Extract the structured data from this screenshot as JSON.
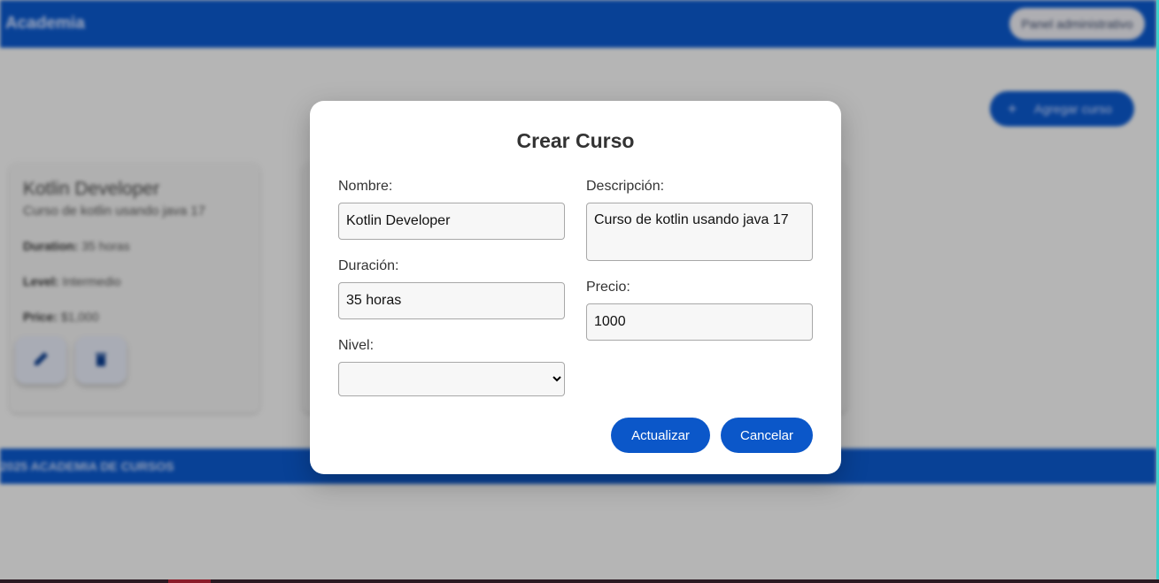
{
  "header": {
    "brand": "Academia",
    "admin_button": "Panel administrativo"
  },
  "toolbar": {
    "add_course_icon": "+",
    "add_course_label": "Agregar curso"
  },
  "course_card": {
    "title": "Kotlin Developer",
    "description": "Curso de kotlin usando java 17",
    "duration_label": "Duration:",
    "duration_value": "35 horas",
    "level_label": "Level:",
    "level_value": "Intermedio",
    "price_label": "Price:",
    "price_value": "$1,000",
    "edit_icon": "pencil-icon",
    "delete_icon": "trash-icon"
  },
  "footer": {
    "text": "2025 ACADEMIA DE CURSOS"
  },
  "modal": {
    "title": "Crear Curso",
    "name_label": "Nombre:",
    "name_value": "Kotlin Developer",
    "description_label": "Descripción:",
    "description_value": "Curso de kotlin usando java 17",
    "duration_label": "Duración:",
    "duration_value": "35 horas",
    "price_label": "Precio:",
    "price_value": "1000",
    "level_label": "Nivel:",
    "level_value": "",
    "update_button": "Actualizar",
    "cancel_button": "Cancelar"
  },
  "colors": {
    "primary": "#0b57c9",
    "surface": "#ffffff",
    "background": "#f2f2f2"
  }
}
